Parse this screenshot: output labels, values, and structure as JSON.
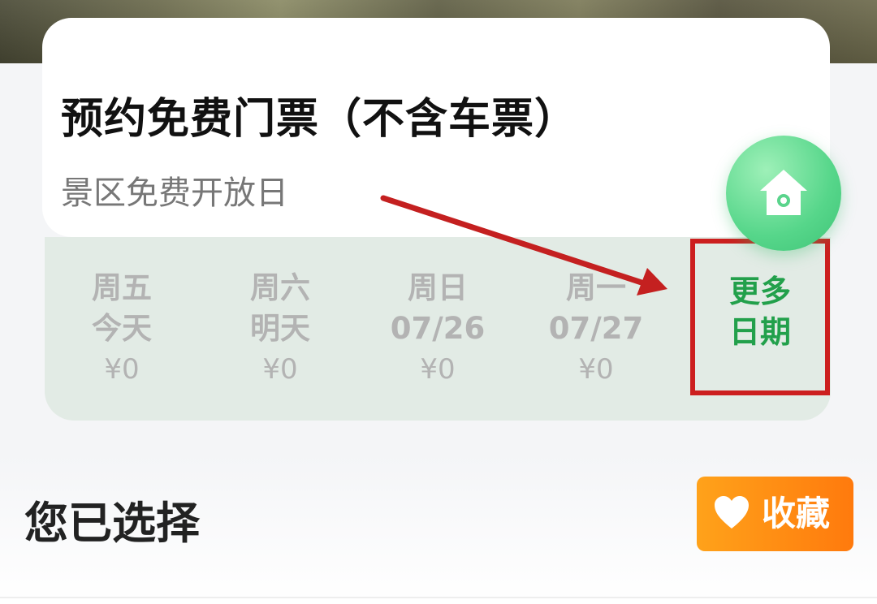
{
  "ticket": {
    "title": "预约免费门票（不含车票）",
    "subtitle": "景区免费开放日"
  },
  "dates": [
    {
      "weekday": "周五",
      "date": "今天",
      "price": "¥0"
    },
    {
      "weekday": "周六",
      "date": "明天",
      "price": "¥0"
    },
    {
      "weekday": "周日",
      "date": "07/26",
      "price": "¥0"
    },
    {
      "weekday": "周一",
      "date": "07/27",
      "price": "¥0"
    }
  ],
  "more_dates": {
    "line1": "更多",
    "line2": "日期"
  },
  "selected": {
    "label": "您已选择"
  },
  "favorite": {
    "label": "收藏",
    "icon": "heart-icon"
  },
  "fab": {
    "icon": "home-icon"
  },
  "colors": {
    "accent_green": "#22a04b",
    "highlight_red": "#cc1f1f",
    "favorite_orange": "#ff8a10",
    "date_strip_bg": "#e2ebe5"
  }
}
